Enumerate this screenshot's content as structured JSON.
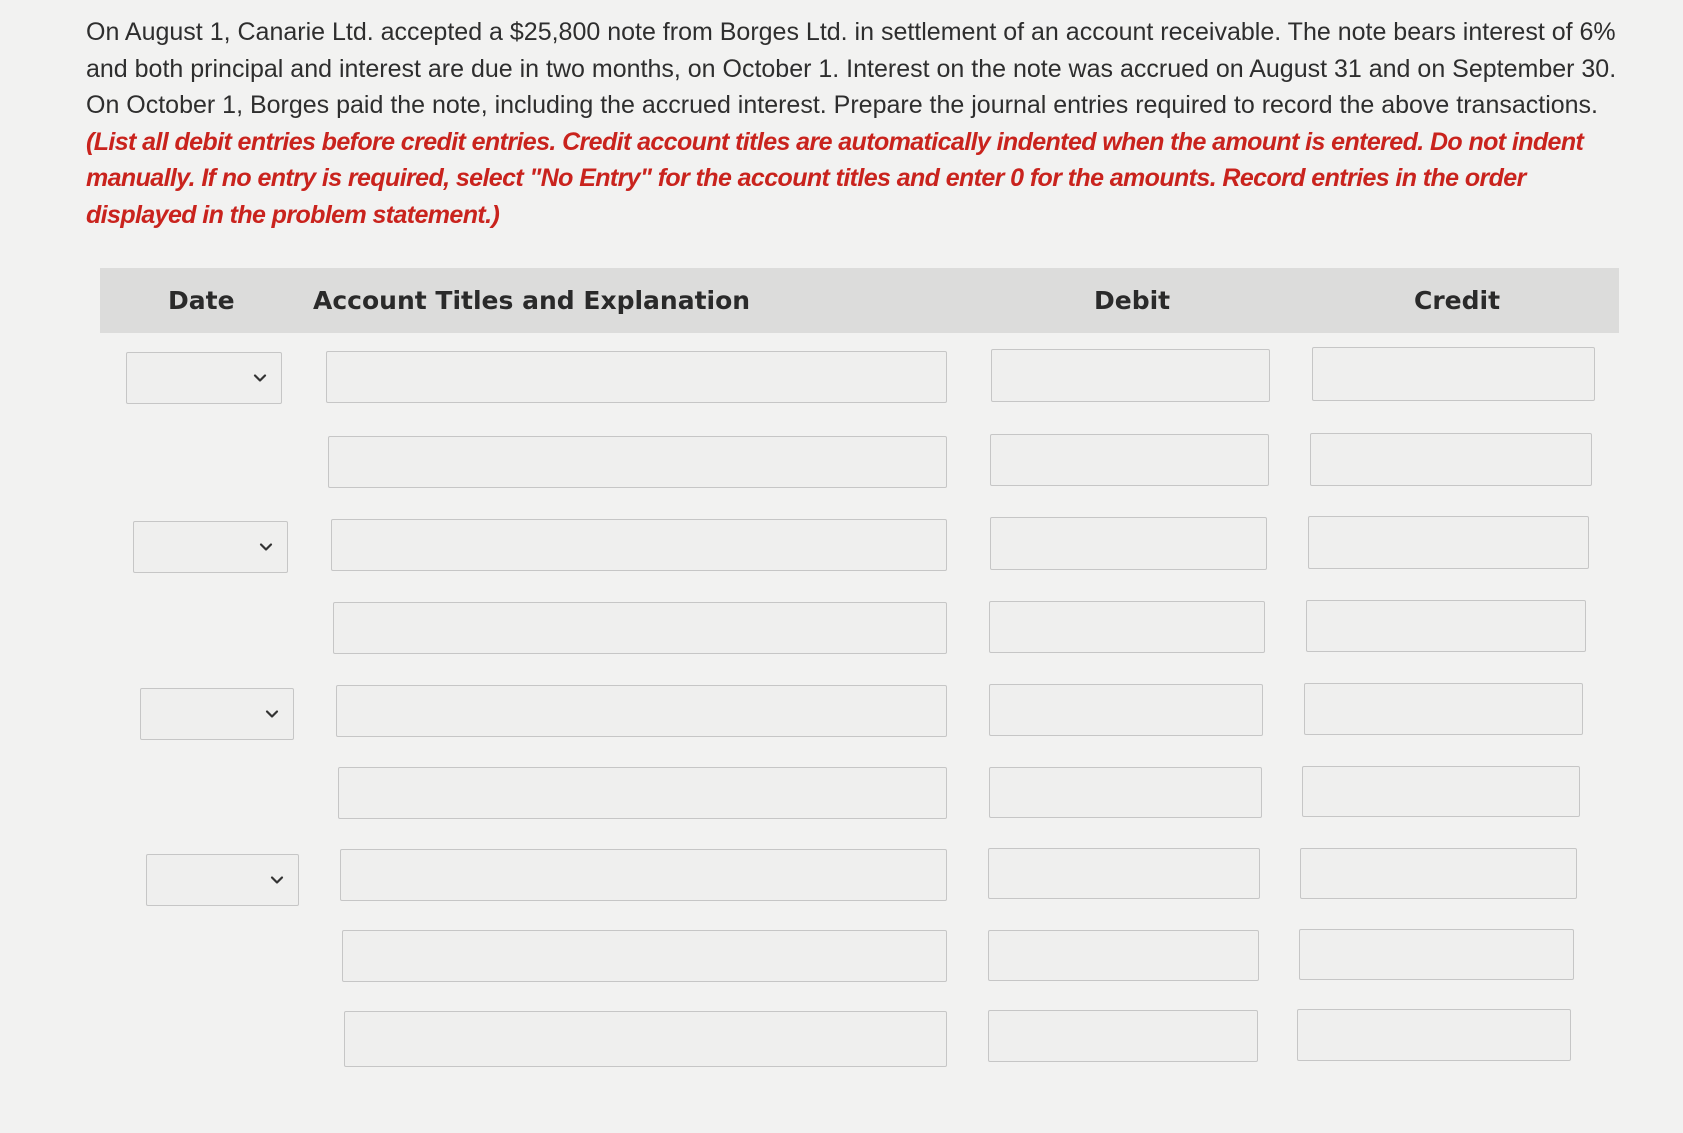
{
  "problem": {
    "statement": "On August 1, Canarie Ltd. accepted a $25,800 note from Borges Ltd. in settlement of an account receivable. The note bears interest of 6% and both principal and interest are due in two months, on October 1. Interest on the note was accrued on August 31 and on September 30. On October 1, Borges paid the note, including the accrued interest. Prepare the journal entries required to record the above transactions. ",
    "instructions": "(List all debit entries before credit entries. Credit account titles are automatically indented when the amount is entered. Do not indent manually. If no entry is required, select \"No Entry\" for the account titles and enter 0 for the amounts. Record entries in the order displayed in the problem statement.)"
  },
  "table": {
    "headers": {
      "date": "Date",
      "account": "Account Titles and Explanation",
      "debit": "Debit",
      "credit": "Credit"
    }
  },
  "icons": {
    "date_select": "chevron-down-icon"
  },
  "colors": {
    "instruction_red": "#c9231d",
    "header_bg": "#dcdcdb",
    "page_bg": "#f2f2f1"
  }
}
